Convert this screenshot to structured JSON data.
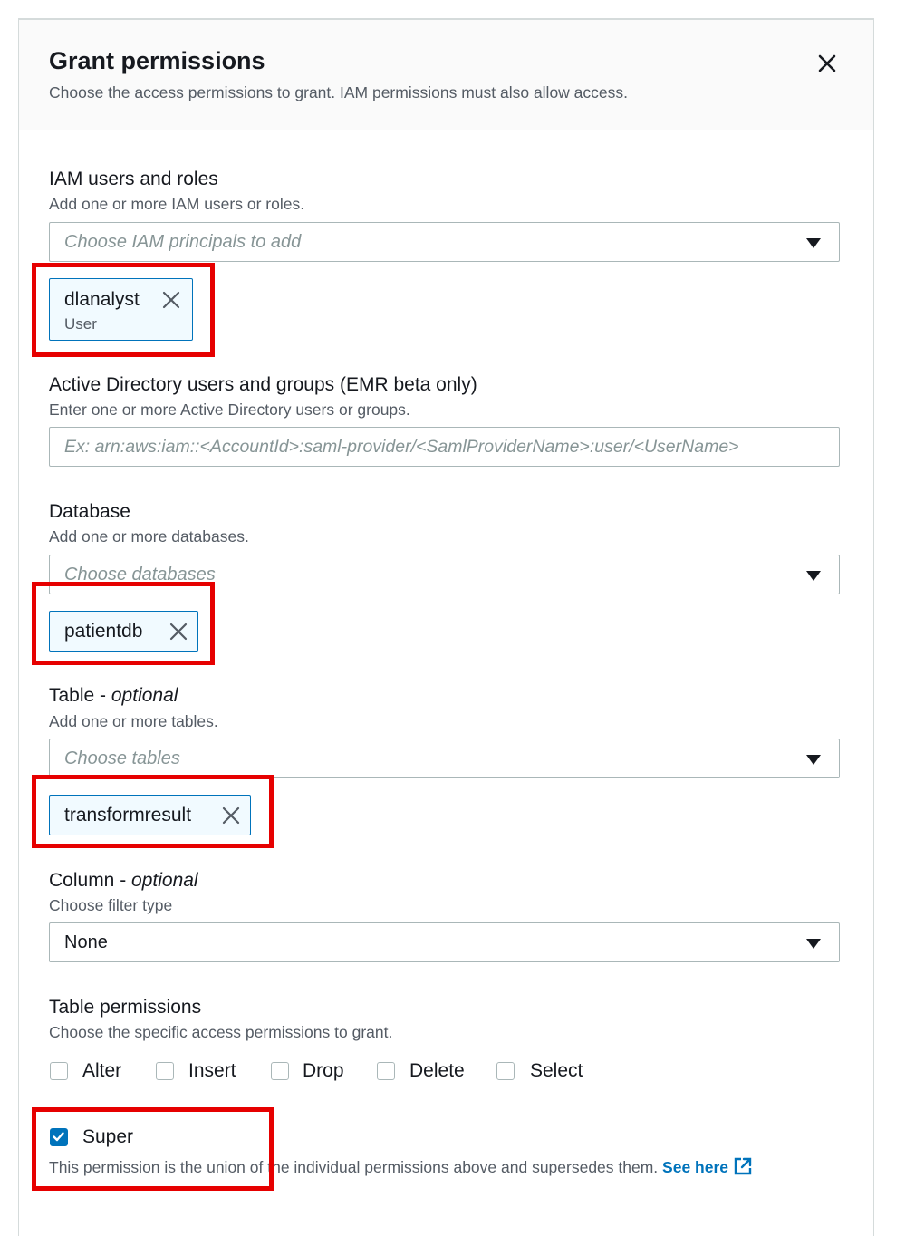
{
  "dialog": {
    "title": "Grant permissions",
    "description": "Choose the access permissions to grant. IAM permissions must also allow access.",
    "close_icon": "close-icon"
  },
  "iam": {
    "label": "IAM users and roles",
    "hint": "Add one or more IAM users or roles.",
    "placeholder": "Choose IAM principals to add",
    "token": {
      "name": "dlanalyst",
      "type": "User"
    }
  },
  "ad": {
    "label": "Active Directory users and groups (EMR beta only)",
    "hint": "Enter one or more Active Directory users or groups.",
    "placeholder": "Ex: arn:aws:iam::<AccountId>:saml-provider/<SamlProviderName>:user/<UserName>"
  },
  "database": {
    "label": "Database",
    "hint": "Add one or more databases.",
    "placeholder": "Choose databases",
    "token": "patientdb"
  },
  "table": {
    "label": "Table - ",
    "label_optional": "optional",
    "hint": "Add one or more tables.",
    "placeholder": "Choose tables",
    "token": "transformresult"
  },
  "column": {
    "label": "Column - ",
    "label_optional": "optional",
    "hint": "Choose filter type",
    "value": "None"
  },
  "permissions": {
    "label": "Table permissions",
    "hint": "Choose the specific access permissions to grant.",
    "options": [
      {
        "label": "Alter",
        "checked": false
      },
      {
        "label": "Insert",
        "checked": false
      },
      {
        "label": "Drop",
        "checked": false
      },
      {
        "label": "Delete",
        "checked": false
      },
      {
        "label": "Select",
        "checked": false
      }
    ],
    "super": {
      "label": "Super",
      "checked": true
    },
    "super_note": "This permission is the union of the individual permissions above and supersedes them.",
    "see_here": "See here"
  },
  "colors": {
    "accent": "#0073bb",
    "highlight": "#e60000"
  }
}
